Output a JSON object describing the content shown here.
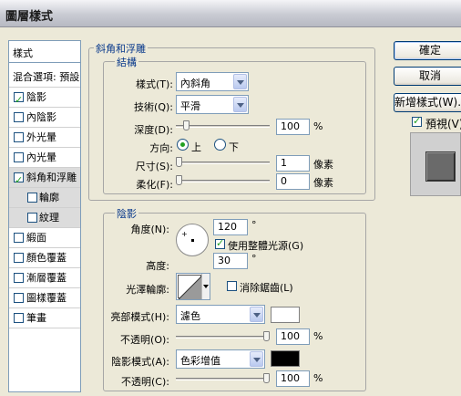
{
  "window": {
    "title": "圖層樣式"
  },
  "style_list": {
    "header": "樣式",
    "blend_options": "混合選項: 預設",
    "items": [
      {
        "label": "陰影",
        "checked": true
      },
      {
        "label": "內陰影",
        "checked": false
      },
      {
        "label": "外光暈",
        "checked": false
      },
      {
        "label": "內光暈",
        "checked": false
      },
      {
        "label": "斜角和浮雕",
        "checked": true
      },
      {
        "label": "輪廓",
        "checked": false
      },
      {
        "label": "紋理",
        "checked": false
      },
      {
        "label": "緞面",
        "checked": false
      },
      {
        "label": "顏色覆蓋",
        "checked": false
      },
      {
        "label": "漸層覆蓋",
        "checked": false
      },
      {
        "label": "圖樣覆蓋",
        "checked": false
      },
      {
        "label": "筆畫",
        "checked": false
      }
    ]
  },
  "bevel": {
    "section_title": "斜角和浮雕",
    "structure_title": "結構",
    "style_label": "樣式(T):",
    "style_value": "內斜角",
    "technique_label": "技術(Q):",
    "technique_value": "平滑",
    "depth_label": "深度(D):",
    "depth_value": "100",
    "depth_unit": "%",
    "depth_slider": 0.08,
    "direction_label": "方向:",
    "dir_up": "上",
    "dir_down": "下",
    "size_label": "尺寸(S):",
    "size_value": "1",
    "size_unit": "像素",
    "size_slider": 0.0,
    "soften_label": "柔化(F):",
    "soften_value": "0",
    "soften_unit": "像素",
    "soften_slider": 0.0
  },
  "shading": {
    "title": "陰影",
    "angle_label": "角度(N):",
    "angle_value": "120",
    "angle_unit": "°",
    "global_light_label": "使用整體光源(G)",
    "global_light_checked": true,
    "altitude_label": "高度:",
    "altitude_value": "30",
    "altitude_unit": "°",
    "gloss_label": "光澤輪廓:",
    "antialias_label": "消除鋸齒(L)",
    "antialias_checked": false,
    "highlight_mode_label": "亮部模式(H):",
    "highlight_mode_value": "濾色",
    "highlight_color": "#ffffff",
    "highlight_opacity_label": "不透明(O):",
    "highlight_opacity_value": "100",
    "highlight_opacity_unit": "%",
    "highlight_opacity_slider": 1.0,
    "shadow_mode_label": "陰影模式(A):",
    "shadow_mode_value": "色彩增值",
    "shadow_color": "#000000",
    "shadow_opacity_label": "不透明(C):",
    "shadow_opacity_value": "100",
    "shadow_opacity_unit": "%",
    "shadow_opacity_slider": 1.0
  },
  "buttons": {
    "ok": "確定",
    "cancel": "取消",
    "new_style": "新增樣式(W)...",
    "preview_label": "預視(V)",
    "preview_checked": true
  }
}
